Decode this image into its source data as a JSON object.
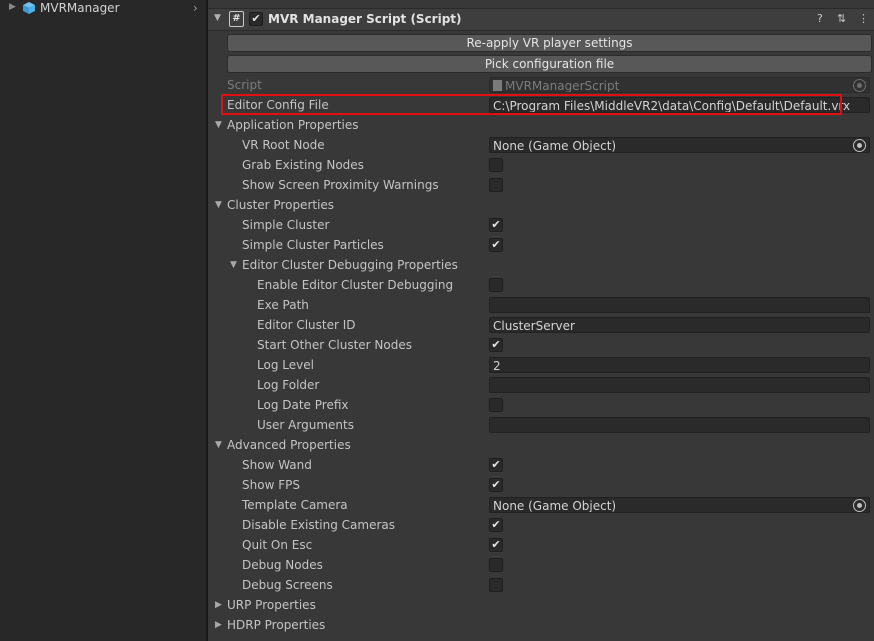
{
  "hierarchy": {
    "object_name": "MVRManager"
  },
  "component": {
    "title": "MVR Manager Script (Script)",
    "help_glyph": "?",
    "presets_glyph": "⇅",
    "menu_glyph": "⋮"
  },
  "buttons": {
    "reapply": "Re-apply VR player settings",
    "pick_config": "Pick configuration file"
  },
  "fields": {
    "script_label": "Script",
    "script_value": "MVRManagerScript",
    "editor_config_label": "Editor Config File",
    "editor_config_value": "C:\\Program Files\\MiddleVR2\\data\\Config\\Default\\Default.vrx"
  },
  "application": {
    "header": "Application Properties",
    "vr_root_node_label": "VR Root Node",
    "vr_root_node_value": "None (Game Object)",
    "grab_existing_nodes_label": "Grab Existing Nodes",
    "show_screen_proximity_label": "Show Screen Proximity Warnings"
  },
  "cluster": {
    "header": "Cluster Properties",
    "simple_cluster_label": "Simple Cluster",
    "simple_cluster_particles_label": "Simple Cluster Particles",
    "debug_header": "Editor Cluster Debugging Properties",
    "enable_debugging_label": "Enable Editor Cluster Debugging",
    "exe_path_label": "Exe Path",
    "exe_path_value": "",
    "cluster_id_label": "Editor Cluster ID",
    "cluster_id_value": "ClusterServer",
    "start_other_label": "Start Other Cluster Nodes",
    "log_level_label": "Log Level",
    "log_level_value": "2",
    "log_folder_label": "Log Folder",
    "log_folder_value": "",
    "log_date_prefix_label": "Log Date Prefix",
    "user_arguments_label": "User Arguments",
    "user_arguments_value": ""
  },
  "advanced": {
    "header": "Advanced Properties",
    "show_wand_label": "Show Wand",
    "show_fps_label": "Show FPS",
    "template_camera_label": "Template Camera",
    "template_camera_value": "None (Game Object)",
    "disable_existing_cameras_label": "Disable Existing Cameras",
    "quit_on_esc_label": "Quit On Esc",
    "debug_nodes_label": "Debug Nodes",
    "debug_screens_label": "Debug Screens"
  },
  "urp": {
    "header": "URP Properties"
  },
  "hdrp": {
    "header": "HDRP Properties"
  },
  "checkbox_states": {
    "component_enabled": true,
    "grab_existing_nodes": false,
    "show_screen_proximity_warnings": false,
    "simple_cluster": true,
    "simple_cluster_particles": true,
    "enable_editor_cluster_debugging": false,
    "start_other_cluster_nodes": true,
    "log_date_prefix": false,
    "show_wand": true,
    "show_fps": true,
    "disable_existing_cameras": true,
    "quit_on_esc": true,
    "debug_nodes": false,
    "debug_screens": false
  },
  "colors": {
    "highlight": "#e01010",
    "background": "#383838",
    "hierarchy_bg": "#282828"
  }
}
